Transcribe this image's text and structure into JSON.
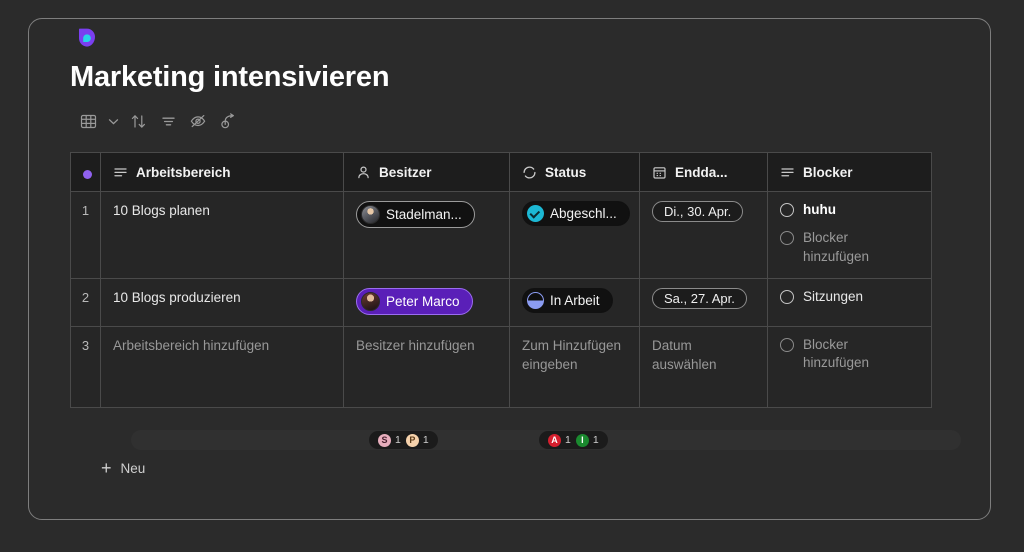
{
  "brand": {
    "logo_icon": "monday-drop-logo",
    "accent": "#7a3ff0",
    "accent2": "#27d3e8"
  },
  "header": {
    "title": "Marketing intensivieren"
  },
  "toolbar": {
    "items": [
      {
        "name": "table-view-button",
        "icon": "grid-icon",
        "label": ""
      },
      {
        "name": "view-chevron-button",
        "icon": "chevron-down-icon",
        "label": ""
      },
      {
        "name": "sort-button",
        "icon": "sort-arrows-icon",
        "label": ""
      },
      {
        "name": "filter-button",
        "icon": "filter-icon",
        "label": ""
      },
      {
        "name": "hide-fields-button",
        "icon": "eye-off-icon",
        "label": ""
      },
      {
        "name": "automation-button",
        "icon": "automation-arrow-icon",
        "label": ""
      }
    ]
  },
  "table": {
    "columns": [
      {
        "label": "Arbeitsbereich",
        "icon": "text-lines-icon"
      },
      {
        "label": "Besitzer",
        "icon": "person-icon"
      },
      {
        "label": "Status",
        "icon": "dashed-circle-icon"
      },
      {
        "label": "Endda...",
        "icon": "calendar-icon"
      },
      {
        "label": "Blocker",
        "icon": "text-lines-icon"
      }
    ],
    "rows": [
      {
        "number": "1",
        "workspace": "10 Blogs planen",
        "owner": {
          "name": "Stadelman...",
          "style": "outline"
        },
        "status": {
          "label": "Abgeschl...",
          "type": "done"
        },
        "end_date": "Di., 30. Apr.",
        "blockers": [
          {
            "label": "huhu",
            "placeholder": false
          },
          {
            "label": "Blocker hinzufügen",
            "placeholder": true
          }
        ]
      },
      {
        "number": "2",
        "workspace": "10 Blogs produzieren",
        "owner": {
          "name": "Peter Marco",
          "style": "accent"
        },
        "status": {
          "label": "In Arbeit",
          "type": "progress"
        },
        "end_date": "Sa., 27. Apr.",
        "blockers": [
          {
            "label": "Sitzungen",
            "placeholder": false
          }
        ]
      },
      {
        "number": "3",
        "workspace": "Arbeitsbereich hinzufügen",
        "owner_placeholder": "Besitzer hinzufügen",
        "status_placeholder": "Zum Hinzufügen eingeben",
        "date_placeholder": "Datum auswählen",
        "blocker_placeholder": "Blocker hinzufügen"
      }
    ]
  },
  "summary": {
    "groups": [
      {
        "items": [
          {
            "letter": "S",
            "count": "1",
            "color": "#e8aebd",
            "text_color": "#4a2230"
          },
          {
            "letter": "P",
            "count": "1",
            "color": "#f6d2ac",
            "text_color": "#5a3a18"
          }
        ]
      },
      {
        "items": [
          {
            "letter": "A",
            "count": "1",
            "color": "#d61f2e",
            "text_color": "#ffffff"
          },
          {
            "letter": "I",
            "count": "1",
            "color": "#1a8a2f",
            "text_color": "#ffffff"
          }
        ]
      }
    ]
  },
  "footer": {
    "new_row_label": "Neu",
    "plus_icon": "plus-icon"
  }
}
